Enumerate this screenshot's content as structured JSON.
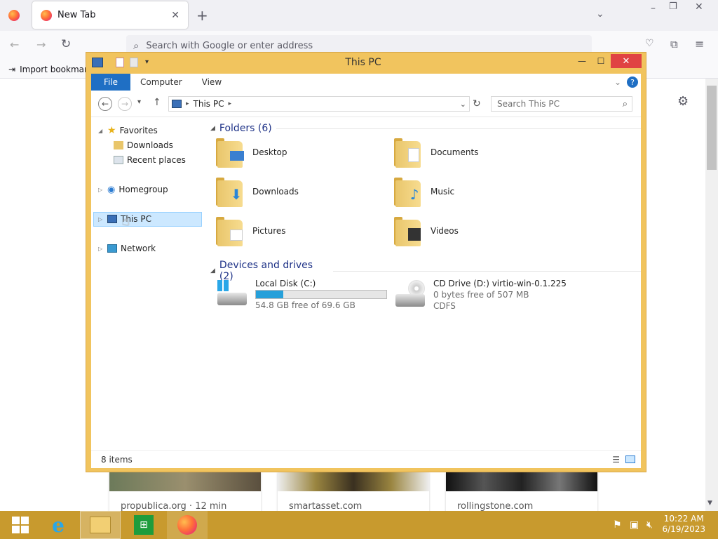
{
  "browser": {
    "tab_title": "New Tab",
    "url_placeholder": "Search with Google or enter address",
    "bookmark_label": "Import bookmark",
    "cards": [
      {
        "label": "propublica.org · 12 min"
      },
      {
        "label": "smartasset.com"
      },
      {
        "label": "rollingstone.com"
      }
    ]
  },
  "window": {
    "title": "This PC",
    "ribbon_tabs": [
      "File",
      "Computer",
      "View"
    ],
    "address_path": "This PC",
    "search_placeholder": "Search This PC",
    "nav": {
      "favorites": "Favorites",
      "downloads": "Downloads",
      "recent": "Recent places",
      "homegroup": "Homegroup",
      "thispc": "This PC",
      "network": "Network"
    },
    "folders_header": "Folders (6)",
    "folders": [
      "Desktop",
      "Documents",
      "Downloads",
      "Music",
      "Pictures",
      "Videos"
    ],
    "drives_header": "Devices and drives (2)",
    "drives": [
      {
        "name": "Local Disk (C:)",
        "detail": "54.8 GB free of 69.6 GB",
        "used_fraction": 0.21
      },
      {
        "name": "CD Drive (D:) virtio-win-0.1.225",
        "detail": "0 bytes free of 507 MB",
        "fs": "CDFS"
      }
    ],
    "status": "8 items"
  },
  "taskbar": {
    "time": "10:22 AM",
    "date": "6/19/2023"
  },
  "colors": {
    "window_frame": "#f1c45e",
    "file_tab": "#1f6fc4",
    "taskbar": "#c89a2e",
    "close": "#e04343"
  }
}
